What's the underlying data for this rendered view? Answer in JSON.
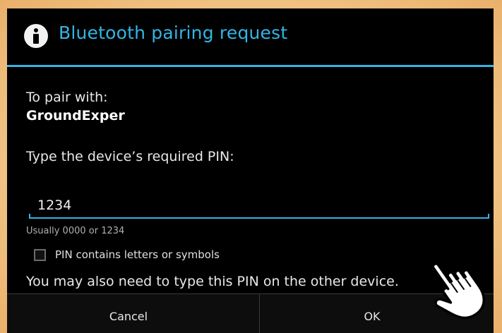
{
  "dialog": {
    "title": "Bluetooth pairing request",
    "pair_label": "To pair with:",
    "device_name": "GroundExper",
    "pin_prompt": "Type the device’s required PIN:",
    "pin_value": "1234",
    "hint": "Usually 0000 or 1234",
    "checkbox_label": "PIN contains letters or symbols",
    "checkbox_checked": false,
    "other_device_note": "You may also need to type this PIN on the other device.",
    "buttons": {
      "cancel": "Cancel",
      "ok": "OK"
    }
  },
  "icons": {
    "title_icon": "info-icon",
    "cursor": "hand-pointer-icon"
  },
  "colors": {
    "accent": "#33b5e5",
    "dialog_background": "#000000",
    "frame": "#f0c181"
  }
}
